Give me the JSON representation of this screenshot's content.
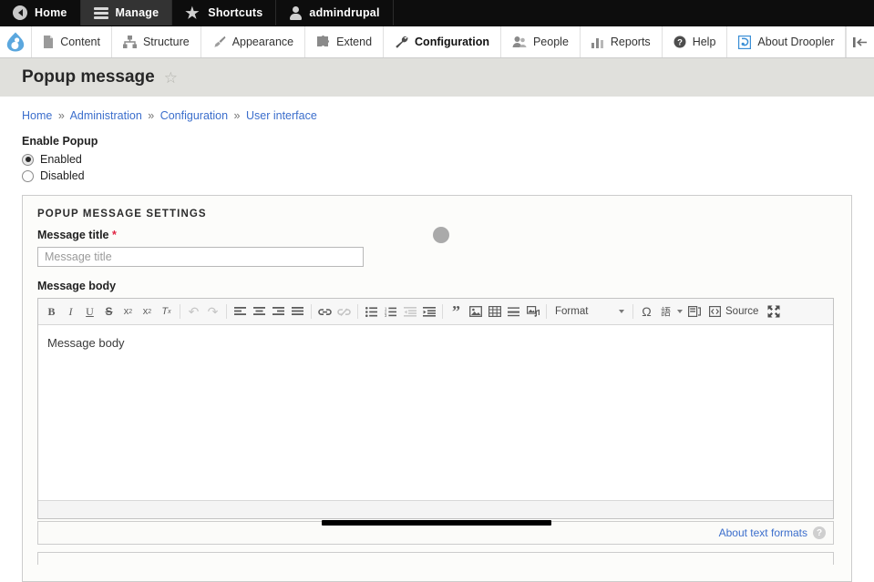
{
  "toolbar_top": {
    "tabs": [
      {
        "label": "Home",
        "icon": "back-arrow-icon",
        "active": false
      },
      {
        "label": "Manage",
        "icon": "hamburger-icon",
        "active": true
      },
      {
        "label": "Shortcuts",
        "icon": "star-icon",
        "active": false
      },
      {
        "label": "admindrupal",
        "icon": "user-icon",
        "active": false
      }
    ]
  },
  "admin_menu": {
    "logo": "drupal-droplet-icon",
    "items": [
      {
        "label": "Content",
        "icon": "file-icon",
        "active": false
      },
      {
        "label": "Structure",
        "icon": "sitemap-icon",
        "active": false
      },
      {
        "label": "Appearance",
        "icon": "paintbrush-icon",
        "active": false
      },
      {
        "label": "Extend",
        "icon": "puzzle-icon",
        "active": false
      },
      {
        "label": "Configuration",
        "icon": "wrench-icon",
        "active": true
      },
      {
        "label": "People",
        "icon": "people-icon",
        "active": false
      },
      {
        "label": "Reports",
        "icon": "bar-chart-icon",
        "active": false
      },
      {
        "label": "Help",
        "icon": "question-circle-icon",
        "active": false
      },
      {
        "label": "About Droopler",
        "icon": "droopler-icon",
        "active": false
      }
    ],
    "collapse_icon": "collapse-toolbar-icon"
  },
  "page": {
    "title": "Popup message",
    "bookmark_icon": "star-outline-icon"
  },
  "breadcrumb": {
    "items": [
      "Home",
      "Administration",
      "Configuration",
      "User interface"
    ],
    "separator": "»"
  },
  "enable_popup": {
    "label": "Enable Popup",
    "options": [
      {
        "label": "Enabled",
        "selected": true
      },
      {
        "label": "Disabled",
        "selected": false
      }
    ]
  },
  "settings": {
    "legend": "POPUP MESSAGE SETTINGS",
    "message_title": {
      "label": "Message title",
      "required_marker": "*",
      "placeholder": "Message title",
      "value": ""
    },
    "message_body": {
      "label": "Message body",
      "placeholder": "Message body"
    }
  },
  "editor": {
    "format_select": "Format",
    "source_label": "Source",
    "buttons": [
      {
        "name": "bold",
        "glyph": "B",
        "disabled": false
      },
      {
        "name": "italic",
        "glyph": "I",
        "disabled": false
      },
      {
        "name": "underline",
        "glyph": "U",
        "disabled": false
      },
      {
        "name": "strikethrough",
        "glyph": "S",
        "disabled": false
      },
      {
        "name": "superscript",
        "glyph": "x²",
        "disabled": false
      },
      {
        "name": "subscript",
        "glyph": "x₂",
        "disabled": false
      },
      {
        "name": "remove-format",
        "glyph": "Tₓ",
        "disabled": false
      },
      {
        "name": "undo",
        "glyph": "↶",
        "disabled": true
      },
      {
        "name": "redo",
        "glyph": "↷",
        "disabled": true
      },
      {
        "name": "align-left",
        "glyph": "≡",
        "disabled": false
      },
      {
        "name": "align-center",
        "glyph": "≡",
        "disabled": false
      },
      {
        "name": "align-right",
        "glyph": "≡",
        "disabled": false
      },
      {
        "name": "justify",
        "glyph": "≡",
        "disabled": false
      },
      {
        "name": "link",
        "glyph": "⚭",
        "disabled": false
      },
      {
        "name": "unlink",
        "glyph": "⚭",
        "disabled": true
      },
      {
        "name": "bulleted-list",
        "glyph": "•≡",
        "disabled": false
      },
      {
        "name": "numbered-list",
        "glyph": "1≡",
        "disabled": false
      },
      {
        "name": "outdent",
        "glyph": "←≡",
        "disabled": true
      },
      {
        "name": "indent",
        "glyph": "→≡",
        "disabled": false
      },
      {
        "name": "blockquote",
        "glyph": "”",
        "disabled": false
      },
      {
        "name": "image",
        "glyph": "Ὓc",
        "disabled": false
      },
      {
        "name": "table",
        "glyph": "⊞",
        "disabled": false
      },
      {
        "name": "horizontal-rule",
        "glyph": "☰",
        "disabled": false
      },
      {
        "name": "media",
        "glyph": "♫",
        "disabled": false
      },
      {
        "name": "special-character",
        "glyph": "Ω",
        "disabled": false
      },
      {
        "name": "language",
        "glyph": "語",
        "disabled": false
      },
      {
        "name": "templates",
        "glyph": "▤",
        "disabled": false
      },
      {
        "name": "maximize",
        "glyph": "⤡",
        "disabled": false
      }
    ]
  },
  "text_format_footer": {
    "about_link": "About text formats",
    "help_icon": "question-mark-icon"
  }
}
